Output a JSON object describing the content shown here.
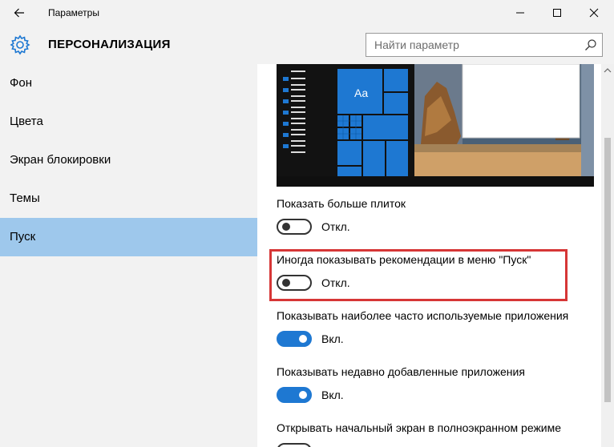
{
  "window": {
    "title": "Параметры",
    "controls": {
      "minimize": "minimize-icon",
      "maximize": "maximize-icon",
      "close": "close-icon"
    }
  },
  "header": {
    "section_title": "ПЕРСОНАЛИЗАЦИЯ",
    "icon": "gear-icon",
    "search_placeholder": "Найти параметр"
  },
  "sidebar": {
    "items": [
      {
        "label": "Фон",
        "active": false
      },
      {
        "label": "Цвета",
        "active": false
      },
      {
        "label": "Экран блокировки",
        "active": false
      },
      {
        "label": "Темы",
        "active": false
      },
      {
        "label": "Пуск",
        "active": true
      }
    ]
  },
  "preview": {
    "tile_label": "Aa"
  },
  "settings": [
    {
      "label": "Показать больше плиток",
      "state": "Откл.",
      "on": false
    },
    {
      "label": "Иногда показывать рекомендации в меню \"Пуск\"",
      "state": "Откл.",
      "on": false,
      "highlighted": true
    },
    {
      "label": "Показывать наиболее часто используемые приложения",
      "state": "Вкл.",
      "on": true
    },
    {
      "label": "Показывать недавно добавленные приложения",
      "state": "Вкл.",
      "on": true
    },
    {
      "label": "Открывать начальный экран в полноэкранном режиме",
      "state": "",
      "on": false
    }
  ],
  "colors": {
    "accent": "#1e78d2",
    "sidebar_active": "#9ec8ec",
    "highlight_border": "#d63636",
    "chrome_bg": "#f2f2f2"
  }
}
